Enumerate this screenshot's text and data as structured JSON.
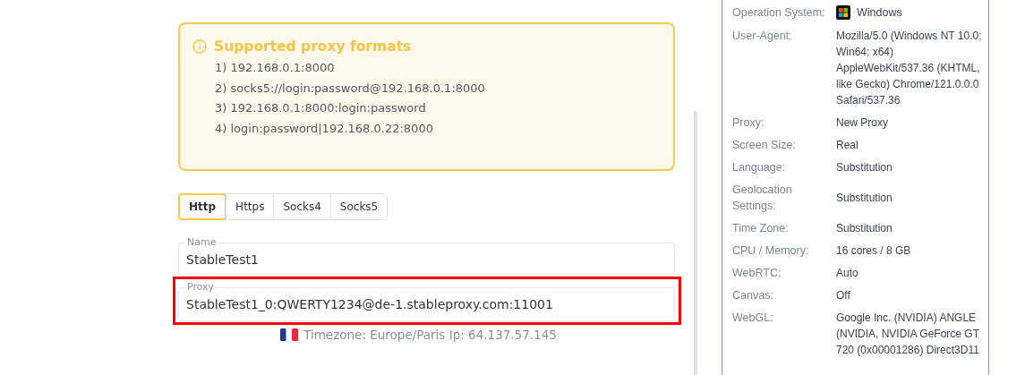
{
  "formats_notice": {
    "title": "Supported proxy formats",
    "items": [
      "1) 192.168.0.1:8000",
      "2) socks5://login:password@192.168.0.1:8000",
      "3) 192.168.0.1:8000:login:password",
      "4) login:password|192.168.0.22:8000"
    ]
  },
  "protocol_tabs": [
    {
      "label": "Http",
      "selected": true
    },
    {
      "label": "Https",
      "selected": false
    },
    {
      "label": "Socks4",
      "selected": false
    },
    {
      "label": "Socks5",
      "selected": false
    }
  ],
  "fields": [
    {
      "label": "Name",
      "value": "StableTest1",
      "highlighted": false
    },
    {
      "label": "Proxy",
      "value": "StableTest1_0:QWERTY1234@de-1.stableproxy.com:11001",
      "highlighted": true
    }
  ],
  "proxy_info": "Timezone: Europe/Paris Ip: 64.137.57.145",
  "summary": [
    {
      "label": "Operation System:",
      "value": "Windows",
      "kind": "os"
    },
    {
      "label": "User-Agent:",
      "value": "Mozilla/5.0 (Windows NT 10.0; Win64; x64) AppleWebKit/537.36 (KHTML, like Gecko) Chrome/121.0.0.0 Safari/537.36",
      "kind": "text"
    },
    {
      "label": "Proxy:",
      "value": "New Proxy",
      "kind": "text"
    },
    {
      "label": "Screen Size:",
      "value": "Real",
      "kind": "text"
    },
    {
      "label": "Language:",
      "value": "Substitution",
      "kind": "text"
    },
    {
      "label": "Geolocation Settings:",
      "value": "Substitution",
      "kind": "text"
    },
    {
      "label": "Time Zone:",
      "value": "Substitution",
      "kind": "text"
    },
    {
      "label": "CPU / Memory:",
      "value": "16 cores / 8 GB",
      "kind": "text"
    },
    {
      "label": "WebRTC:",
      "value": "Auto",
      "kind": "text"
    },
    {
      "label": "Canvas:",
      "value": "Off",
      "kind": "text"
    },
    {
      "label": "WebGL:",
      "value": "Google Inc. (NVIDIA) ANGLE (NVIDIA, NVIDIA GeForce GT 720 (0x00001286) Direct3D11",
      "kind": "text"
    }
  ]
}
